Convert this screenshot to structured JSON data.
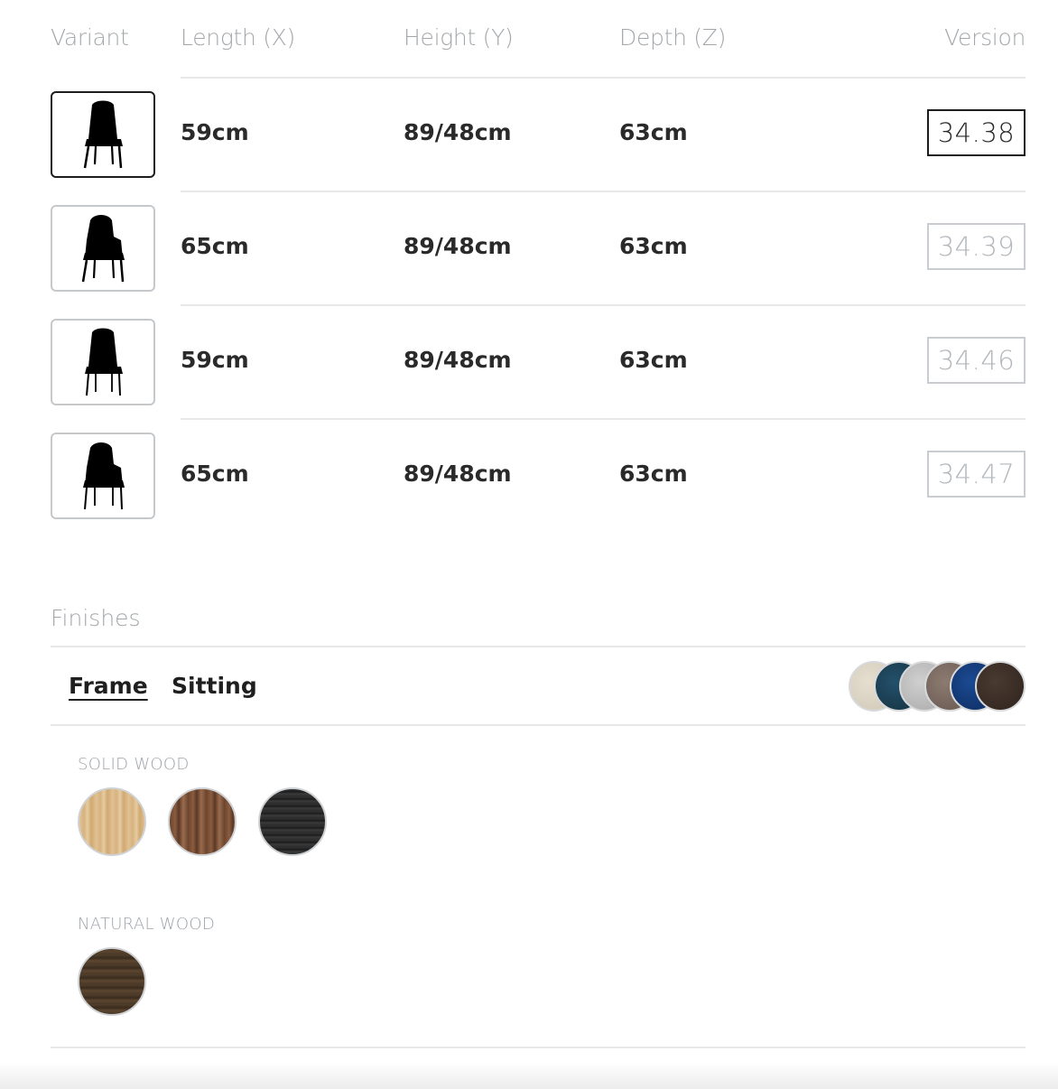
{
  "table": {
    "headers": {
      "variant": "Variant",
      "length": "Length (X)",
      "height": "Height (Y)",
      "depth": "Depth (Z)",
      "version": "Version"
    },
    "rows": [
      {
        "length": "59cm",
        "height": "89/48cm",
        "depth": "63cm",
        "version": "34.38",
        "selected": true,
        "icon": "chair-icon"
      },
      {
        "length": "65cm",
        "height": "89/48cm",
        "depth": "63cm",
        "version": "34.39",
        "selected": false,
        "icon": "armchair-icon"
      },
      {
        "length": "59cm",
        "height": "89/48cm",
        "depth": "63cm",
        "version": "34.46",
        "selected": false,
        "icon": "chair-icon"
      },
      {
        "length": "65cm",
        "height": "89/48cm",
        "depth": "63cm",
        "version": "34.47",
        "selected": false,
        "icon": "armchair-icon"
      }
    ]
  },
  "finishes": {
    "title": "Finishes",
    "tabs": {
      "frame": "Frame",
      "sitting": "Sitting",
      "active": "Frame"
    },
    "sitting_preview_colors": [
      "#d9d2c3",
      "#1d3e55",
      "#bdbdbd",
      "#7a6a60",
      "#123a78",
      "#3e3129"
    ],
    "groups": {
      "solid_wood": {
        "label": "SOLID WOOD",
        "swatches": [
          {
            "name": "light-oak-swatch",
            "color": "#d8b686"
          },
          {
            "name": "walnut-swatch",
            "color": "#7a5138"
          },
          {
            "name": "black-wood-swatch",
            "color": "#2a2a2a"
          }
        ]
      },
      "natural_wood": {
        "label": "NATURAL WOOD",
        "swatches": [
          {
            "name": "dark-oak-swatch",
            "color": "#4b3a2a"
          }
        ]
      }
    }
  }
}
